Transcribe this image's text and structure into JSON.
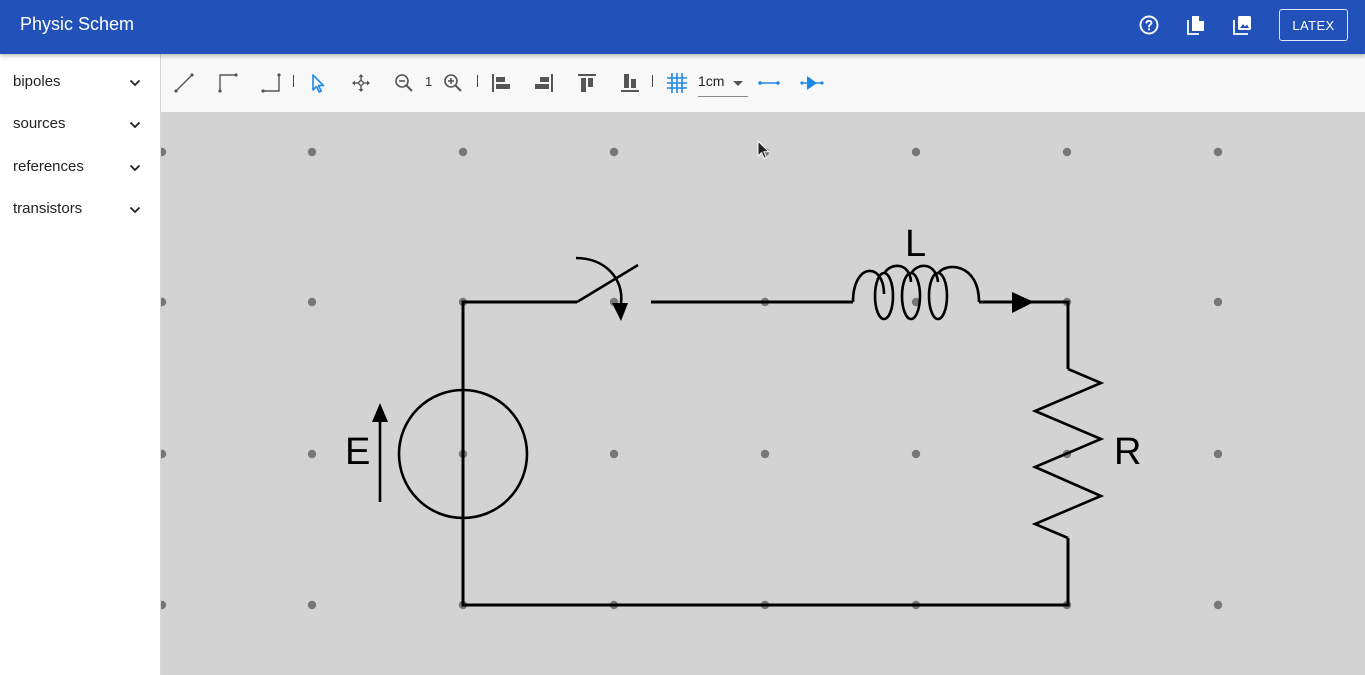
{
  "app": {
    "title": "Physic Schem",
    "actions": [
      {
        "name": "help",
        "icon": "help-circle-icon"
      },
      {
        "name": "copy",
        "icon": "file-copy-icon"
      },
      {
        "name": "image",
        "icon": "image-export-icon"
      }
    ],
    "latex_label": "LATEX"
  },
  "sidebar": {
    "items": [
      {
        "label": "bipoles"
      },
      {
        "label": "sources"
      },
      {
        "label": "references"
      },
      {
        "label": "transistors"
      }
    ]
  },
  "toolbar": {
    "tools": [
      "wire-diagonal-icon",
      "wire-corner-up-icon",
      "wire-corner-down-icon",
      "select-pointer-icon",
      "move-icon",
      "zoom-out-icon",
      "zoom-in-icon",
      "align-left-icon",
      "align-right-icon",
      "align-top-icon",
      "align-bottom-icon",
      "grid-icon",
      "connector-icon",
      "arrow-direction-icon"
    ],
    "zoom_level": "1",
    "grid_size": "1cm"
  },
  "colors": {
    "appbar": "#2151b9",
    "canvas": "#d3d3d3",
    "accent": "#1e88e5"
  },
  "circuit": {
    "source_label": "E",
    "inductor_label": "L",
    "resistor_label": "R"
  }
}
